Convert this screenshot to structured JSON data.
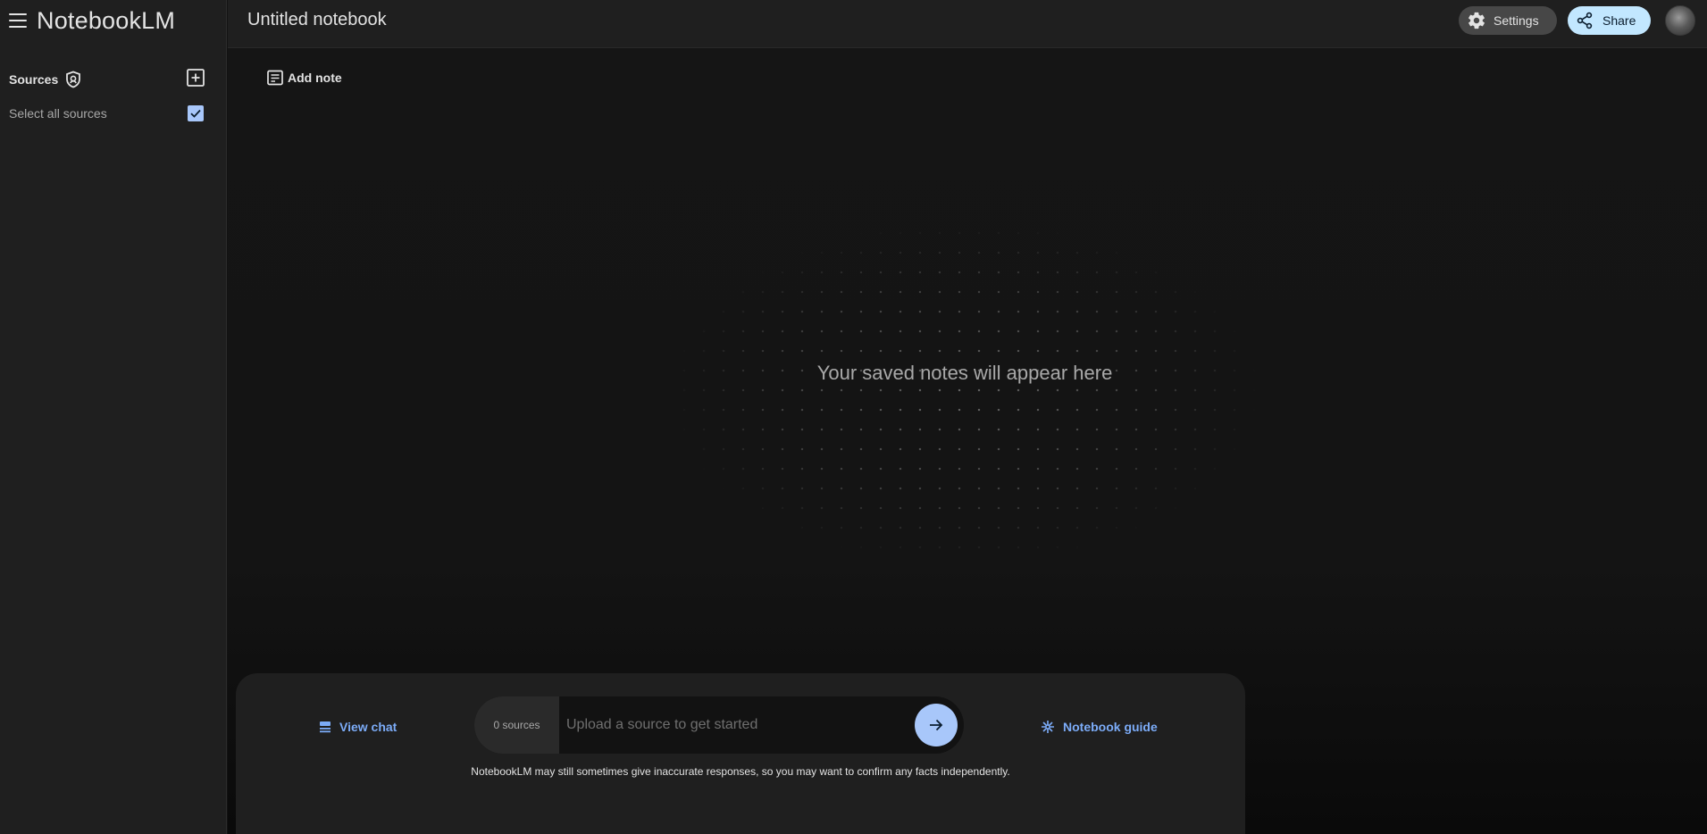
{
  "app": {
    "name": "NotebookLM"
  },
  "sidebar": {
    "sources_title": "Sources",
    "select_all_label": "Select all sources",
    "select_all_checked": true,
    "icons": {
      "menu": "menu-icon",
      "shield": "shield-icon",
      "add": "add-box-icon",
      "check": "check-icon"
    }
  },
  "header": {
    "notebook_title": "Untitled notebook",
    "settings_label": "Settings",
    "share_label": "Share",
    "icons": {
      "settings": "gear-icon",
      "share": "share-icon"
    }
  },
  "notes": {
    "add_note_label": "Add note",
    "empty_message": "Your saved notes will appear here"
  },
  "chat": {
    "view_chat_label": "View chat",
    "source_count": "0 sources",
    "input_placeholder": "Upload a source to get started",
    "input_value": "",
    "notebook_guide_label": "Notebook guide",
    "disclaimer": "NotebookLM may still sometimes give inaccurate responses, so you may want to confirm any facts independently."
  },
  "colors": {
    "background": "#131313",
    "panel": "#1f1f1f",
    "accent": "#a8c7fa",
    "link": "#7cacf8",
    "share_bg": "#c2e7ff"
  }
}
